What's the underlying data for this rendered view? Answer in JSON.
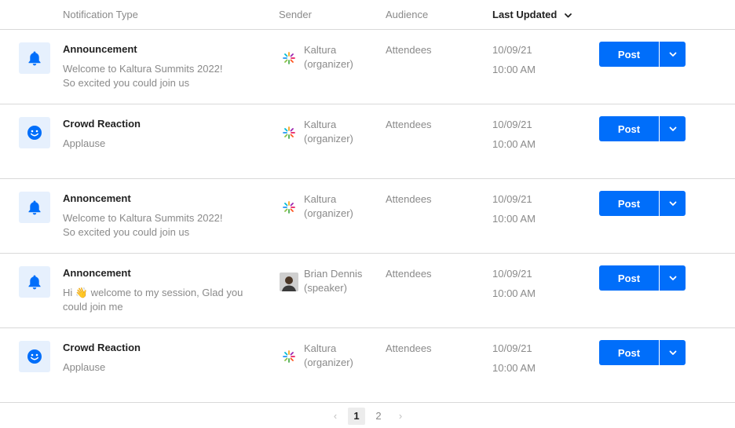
{
  "header": {
    "columns": [
      "Notification Type",
      "Sender",
      "Audience",
      "Last Updated"
    ]
  },
  "colors": {
    "accent": "#006efa",
    "icon_bg": "#e6f0fd",
    "divider": "#d9d9d9",
    "muted_text": "#8a8a8a"
  },
  "rows": [
    {
      "icon": "bell-icon",
      "title": "Announcement",
      "message_lines": [
        "Welcome to Kaltura Summits 2022!",
        "So excited you could join us"
      ],
      "sender_icon": "kaltura-logo-icon",
      "sender_name": "Kaltura",
      "sender_role": "(organizer)",
      "audience": "Attendees",
      "date": "10/09/21",
      "time": "10:00 AM",
      "post_label": "Post"
    },
    {
      "icon": "smiley-icon",
      "title": "Crowd Reaction",
      "message_lines": [
        "Applause"
      ],
      "sender_icon": "kaltura-logo-icon",
      "sender_name": "Kaltura",
      "sender_role": "(organizer)",
      "audience": "Attendees",
      "date": "10/09/21",
      "time": "10:00 AM",
      "post_label": "Post"
    },
    {
      "icon": "bell-icon",
      "title": "Annoncement",
      "message_lines": [
        "Welcome to Kaltura Summits 2022!",
        "So excited you could join us"
      ],
      "sender_icon": "kaltura-logo-icon",
      "sender_name": "Kaltura",
      "sender_role": "(organizer)",
      "audience": "Attendees",
      "date": "10/09/21",
      "time": "10:00 AM",
      "post_label": "Post"
    },
    {
      "icon": "bell-icon",
      "title": "Annoncement",
      "message_lines": [
        "Hi 👋 welcome to my session, Glad you",
        "could join me"
      ],
      "sender_icon": "user-avatar",
      "sender_name": "Brian Dennis",
      "sender_role": "(speaker)",
      "audience": "Attendees",
      "date": "10/09/21",
      "time": "10:00 AM",
      "post_label": "Post"
    },
    {
      "icon": "smiley-icon",
      "title": "Crowd Reaction",
      "message_lines": [
        "Applause"
      ],
      "sender_icon": "kaltura-logo-icon",
      "sender_name": "Kaltura",
      "sender_role": "(organizer)",
      "audience": "Attendees",
      "date": "10/09/21",
      "time": "10:00 AM",
      "post_label": "Post"
    }
  ],
  "pagination": {
    "prev": "‹",
    "pages": [
      "1",
      "2"
    ],
    "current": "1",
    "next": "›"
  }
}
